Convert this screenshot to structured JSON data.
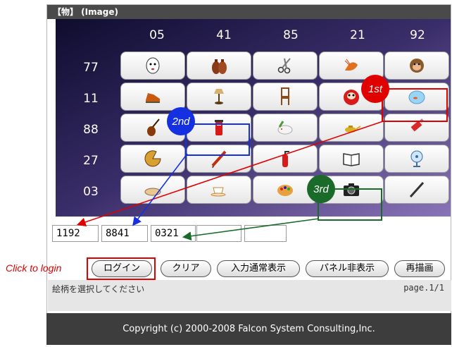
{
  "window": {
    "title": "【物】 (Image)"
  },
  "columns": [
    "05",
    "41",
    "85",
    "21",
    "92"
  ],
  "rows": [
    {
      "label": "77",
      "icons": [
        "mask-icon",
        "jars-icon",
        "scissors-icon",
        "shrimp-icon",
        "monkey-face-icon"
      ]
    },
    {
      "label": "11",
      "icons": [
        "shoe-icon",
        "lamp-icon",
        "chair-icon",
        "daruma-icon",
        "goldfish-bowl-icon"
      ]
    },
    {
      "label": "88",
      "icons": [
        "violin-icon",
        "mailbox-icon",
        "rabbit-icon",
        "magic-lamp-icon",
        "toothpaste-icon"
      ]
    },
    {
      "label": "27",
      "icons": [
        "pie-icon",
        "pencil-icon",
        "fire-extinguisher-icon",
        "book-icon",
        "fan-icon"
      ]
    },
    {
      "label": "03",
      "icons": [
        "plate-icon",
        "teacup-icon",
        "palette-icon",
        "camera-icon",
        "pen-icon"
      ]
    }
  ],
  "inputs": {
    "values": [
      "1192",
      "8841",
      "0321",
      "",
      ""
    ]
  },
  "buttons": {
    "login": "ログイン",
    "clear": "クリア",
    "normal_display": "入力通常表示",
    "hide_panel": "パネル非表示",
    "redraw": "再描画"
  },
  "status": {
    "message": "絵柄を選択してください",
    "page": "page.1/1"
  },
  "footer": {
    "copyright": "Copyright (c) 2000-2008 Falcon System Consulting,Inc."
  },
  "annotations": {
    "first": "1st",
    "second": "2nd",
    "third": "3rd",
    "click_to_login": "Click to login"
  },
  "colors": {
    "red": "#e00000",
    "blue": "#1530e0",
    "green": "#1a6a2a"
  }
}
